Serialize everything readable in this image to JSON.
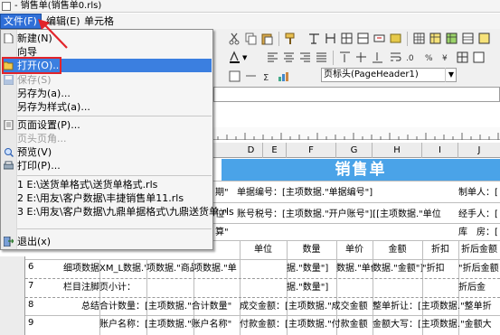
{
  "window": {
    "title": "- 销售单(销售单0.rls)"
  },
  "menubar": {
    "file": "文件(F)",
    "edit": "编辑(E)",
    "cell": "单元格"
  },
  "file_menu": {
    "new": "新建(N)",
    "wizard": "向导",
    "open": "打开(O)...",
    "save": "保存(S)",
    "save_as": "另存为(a)...",
    "save_as_style": "另存为样式(a)...",
    "page_setup": "页面设置(P)...",
    "header_footer": "页头页角...",
    "preview": "预览(V)",
    "print": "打印(P)...",
    "recent": [
      "1 E:\\送货单格式\\送货单格式.rls",
      "2 E:\\用友\\客户数据\\丰捷销售单11.rls",
      "3 E:\\用友\\客户数据\\九鼎单据格式\\九鼎送货单.rls"
    ],
    "exit": "退出(x)"
  },
  "toolbar": {
    "page_header_combo": "页标头(PageHeader1)"
  },
  "sheet": {
    "columns": [
      "D",
      "E",
      "F",
      "G",
      "H",
      "I",
      "J"
    ],
    "banner": "销售单",
    "row_numbers": [
      "6",
      "7",
      "8",
      "9"
    ],
    "header_rows": {
      "r1": [
        "期\"",
        "单据编号：[主项数据.\"单据编号\"]",
        "制单人：["
      ],
      "r2": [
        "位\"",
        "账号税号：[主项数据.\"开户账号\"][[主项数据.\"单位",
        "经手人：["
      ],
      "r3": [
        "算\"",
        "库　房：["
      ]
    },
    "table_header": [
      "单位",
      "数量",
      "单价",
      "金额",
      "折扣",
      "折后金额"
    ],
    "rows": [
      {
        "label": "细项数据",
        "cells": [
          "XM_Lir",
          "数据.\"商品",
          "项数据.\"商品名",
          "项数据.\"单",
          "据.\"数量\"]",
          "数据.\"单价",
          "数据.\"金额\"]",
          "\"折扣",
          "\"折后金额"
        ]
      },
      {
        "label": "栏目注脚",
        "cells": [
          "页小计：",
          "",
          "",
          "",
          "据.\"数量\"]",
          "",
          "",
          "",
          "折后金"
        ]
      },
      {
        "label": "总结",
        "cells": [
          "合计数量：[主项数据.\"合计数量\"",
          "成交金额：[主项数据.\"成交金额",
          "整单折让：[主项数据.\"整单折"
        ]
      },
      {
        "label": "",
        "cells": [
          "账户名称：[主项数据.\"账户名称\"",
          "付款金额：[主项数据.\"付款金额",
          "金额大写：[主项数据.\"金额大"
        ]
      }
    ]
  },
  "colors": {
    "menu_highlight": "#2f6fd8",
    "banner": "#4aa3e8",
    "callout": "#e2242a"
  }
}
